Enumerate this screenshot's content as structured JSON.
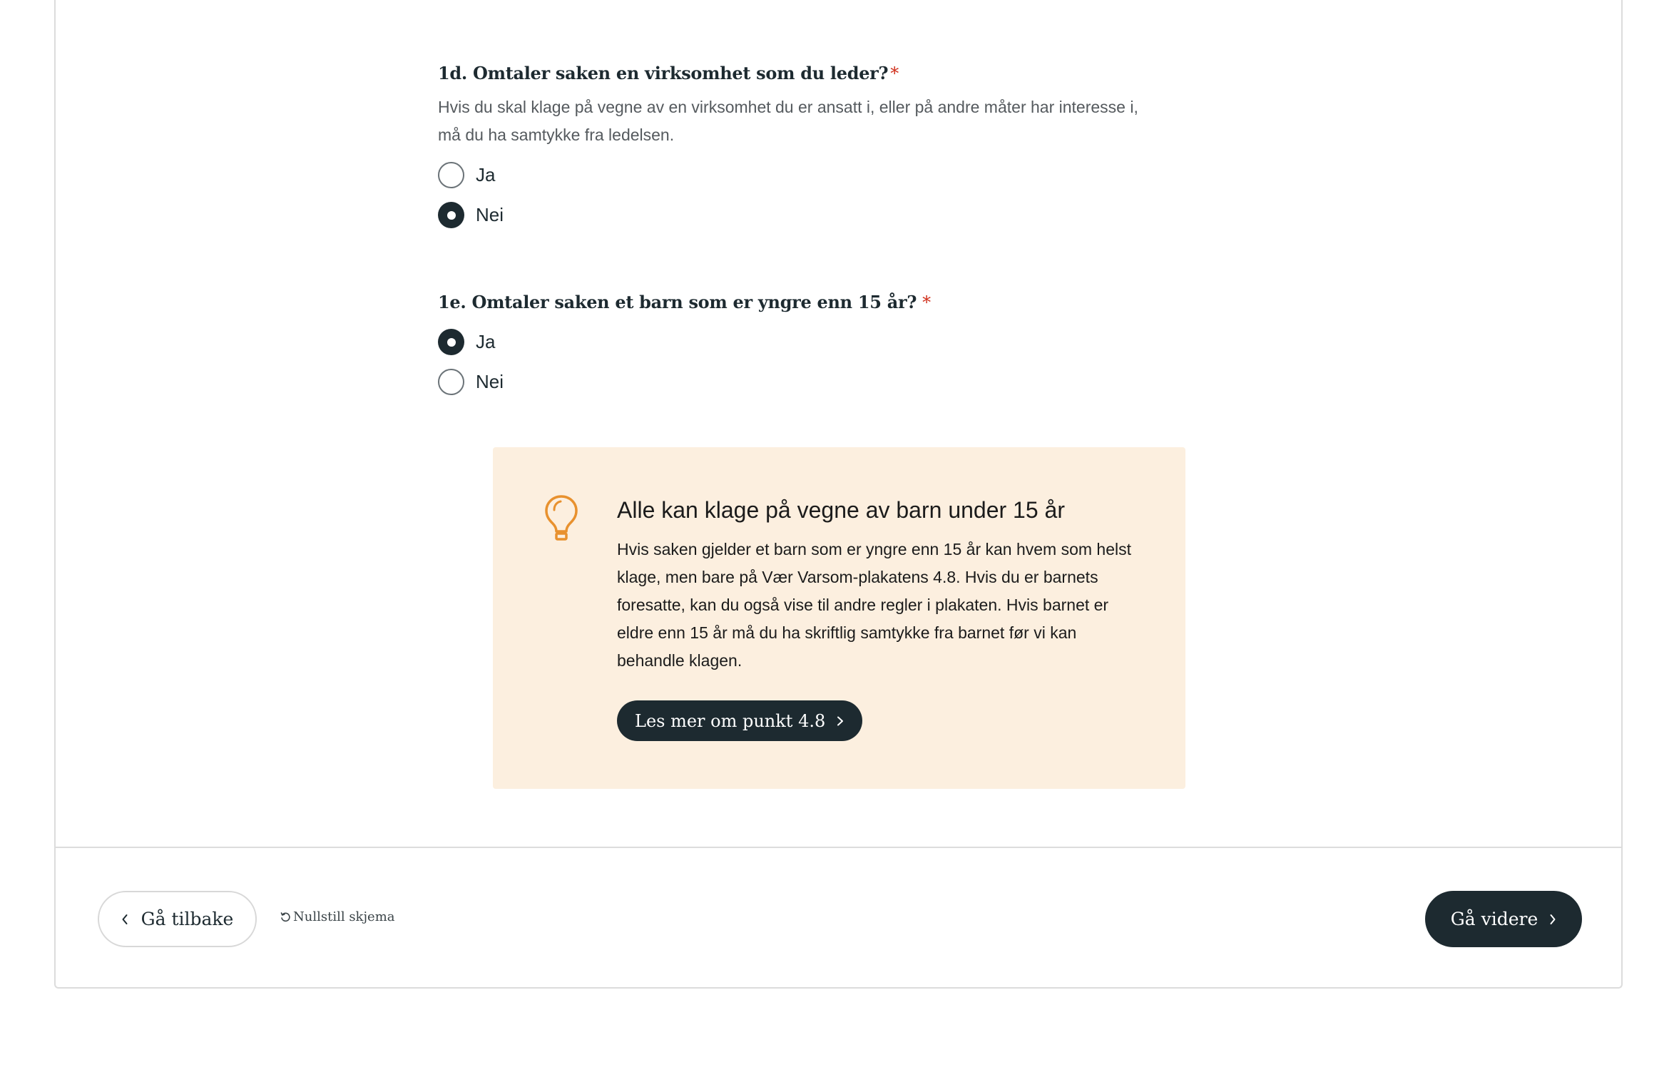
{
  "question_1d": {
    "title": "1d. Omtaler saken en virksomhet som du leder?",
    "required_marker": "*",
    "description": "Hvis du skal klage på vegne av en virksomhet du er ansatt i, eller på andre måter har interesse i, må du ha samtykke fra ledelsen.",
    "options": [
      {
        "label": "Ja",
        "selected": false
      },
      {
        "label": "Nei",
        "selected": true
      }
    ]
  },
  "question_1e": {
    "title": "1e. Omtaler saken et barn som er yngre enn 15 år?",
    "required_marker": "*",
    "options": [
      {
        "label": "Ja",
        "selected": true
      },
      {
        "label": "Nei",
        "selected": false
      }
    ]
  },
  "info_box": {
    "icon": "lightbulb-icon",
    "title": "Alle kan klage på vegne av barn under 15 år",
    "text": "Hvis saken gjelder et barn som er yngre enn 15 år kan hvem som helst klage, men bare på Vær Varsom-plakatens 4.8. Hvis du er barnets foresatte, kan du også vise til andre regler i plakaten. Hvis barnet er eldre enn 15 år må du ha skriftlig samtykke fra barnet før vi kan behandle klagen.",
    "button_label": "Les mer om punkt 4.8",
    "background_color": "#fcefdf",
    "icon_color": "#e8912e"
  },
  "footer": {
    "back_label": "Gå tilbake",
    "reset_label": "Nullstill skjema",
    "next_label": "Gå videre"
  },
  "colors": {
    "primary": "#1d2a30",
    "required": "#d0301c"
  }
}
